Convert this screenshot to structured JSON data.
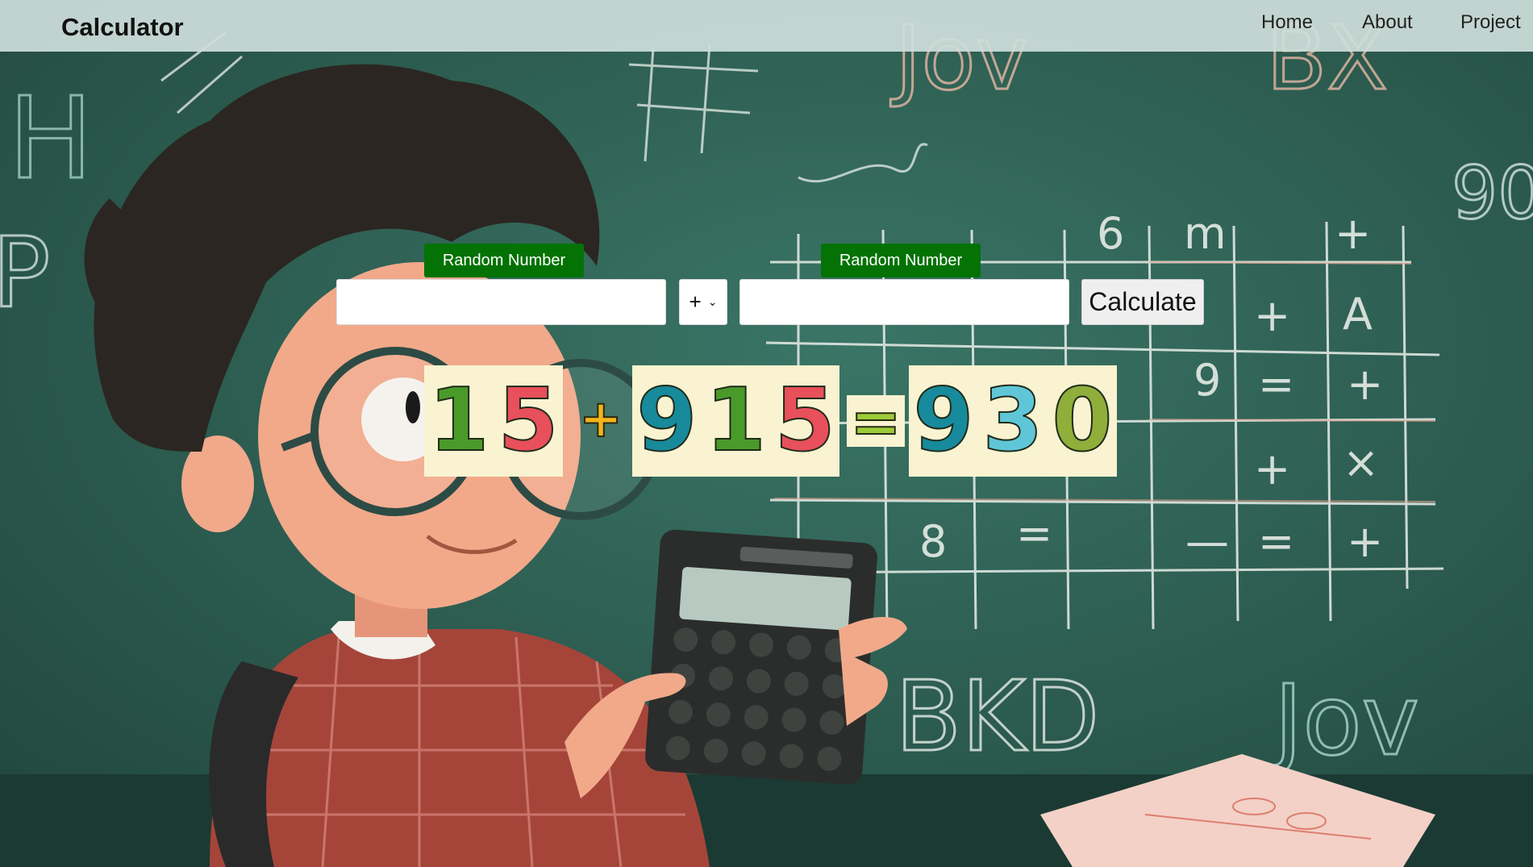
{
  "header": {
    "title": "Calculator",
    "nav": [
      {
        "label": "Home"
      },
      {
        "label": "About"
      },
      {
        "label": "Project"
      }
    ]
  },
  "calculator": {
    "random_label_1": "Random Number",
    "random_label_2": "Random Number",
    "first_number": {
      "value": "",
      "placeholder": ""
    },
    "operator": {
      "selected": "+"
    },
    "second_number": {
      "value": "",
      "placeholder": ""
    },
    "calculate_label": "Calculate"
  },
  "result": {
    "operand_a": {
      "digits": [
        "1",
        "5"
      ],
      "colors": [
        "#4a9a2a",
        "#e8505b"
      ]
    },
    "operator_symbol": "+",
    "operator_color": "#f2b41c",
    "operand_b": {
      "digits": [
        "9",
        "1",
        "5"
      ],
      "colors": [
        "#178a9b",
        "#4a9a2a",
        "#e8505b"
      ]
    },
    "equals_symbol": "=",
    "equals_color": "#9ccc3a",
    "answer": {
      "digits": [
        "9",
        "3",
        "0"
      ],
      "colors": [
        "#178a9b",
        "#5fc6d8",
        "#8fae3a"
      ]
    }
  },
  "colors": {
    "accent": "#047204",
    "chalkboard": "#2c5f52",
    "navbar": "#cddeda"
  }
}
